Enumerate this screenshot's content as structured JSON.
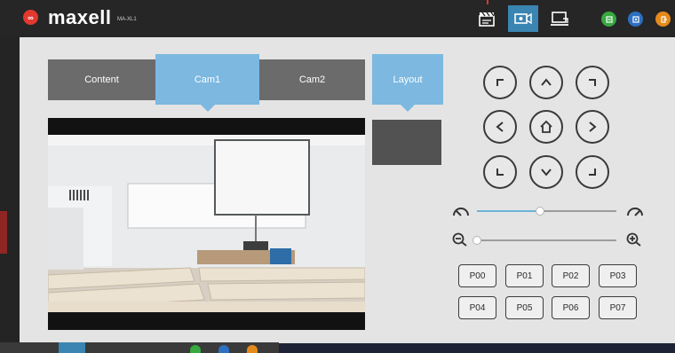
{
  "header": {
    "brand": "maxell",
    "model": "MA-XL1",
    "logo_badge": "∞",
    "icons": [
      {
        "name": "clapper-icon",
        "active": false
      },
      {
        "name": "camera-icon",
        "active": true
      },
      {
        "name": "monitor-icon",
        "active": false
      }
    ],
    "round_icons": [
      {
        "name": "green-app-icon",
        "color": "#36a93f"
      },
      {
        "name": "blue-app-icon",
        "color": "#2d6fc1"
      },
      {
        "name": "orange-app-icon",
        "color": "#e58a1a"
      }
    ]
  },
  "tabs": [
    {
      "label": "Content",
      "active": false
    },
    {
      "label": "Cam1",
      "active": true
    },
    {
      "label": "Cam2",
      "active": false
    }
  ],
  "layout_tab": {
    "label": "Layout"
  },
  "ptz_buttons": [
    {
      "name": "ptz-up-left-button"
    },
    {
      "name": "ptz-up-button"
    },
    {
      "name": "ptz-up-right-button"
    },
    {
      "name": "ptz-left-button"
    },
    {
      "name": "ptz-home-button"
    },
    {
      "name": "ptz-right-button"
    },
    {
      "name": "ptz-down-left-button"
    },
    {
      "name": "ptz-down-button"
    },
    {
      "name": "ptz-down-right-button"
    }
  ],
  "speed_slider": {
    "value": 0.45
  },
  "zoom_slider": {
    "value": 0.0
  },
  "presets": [
    "P00",
    "P01",
    "P02",
    "P03",
    "P04",
    "P05",
    "P06",
    "P07"
  ],
  "colors": {
    "accent_blue": "#7cb8e0",
    "tab_gray": "#6b6b6b",
    "brand_red": "#e2382f"
  }
}
